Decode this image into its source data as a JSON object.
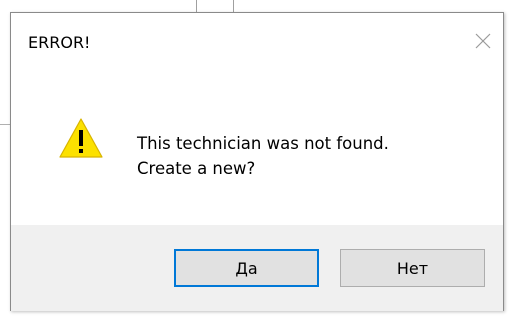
{
  "dialog": {
    "title": "ERROR!",
    "close_icon": "close-icon",
    "warning_icon": "warning-icon",
    "message_lines": [
      "This technician was not found.",
      "Create a new?"
    ],
    "buttons": {
      "yes_label": "Да",
      "no_label": "Нет"
    }
  },
  "colors": {
    "warning_fill": "#FCE100",
    "default_button_border": "#0078D7",
    "footer_bg": "#F0F0F0"
  }
}
